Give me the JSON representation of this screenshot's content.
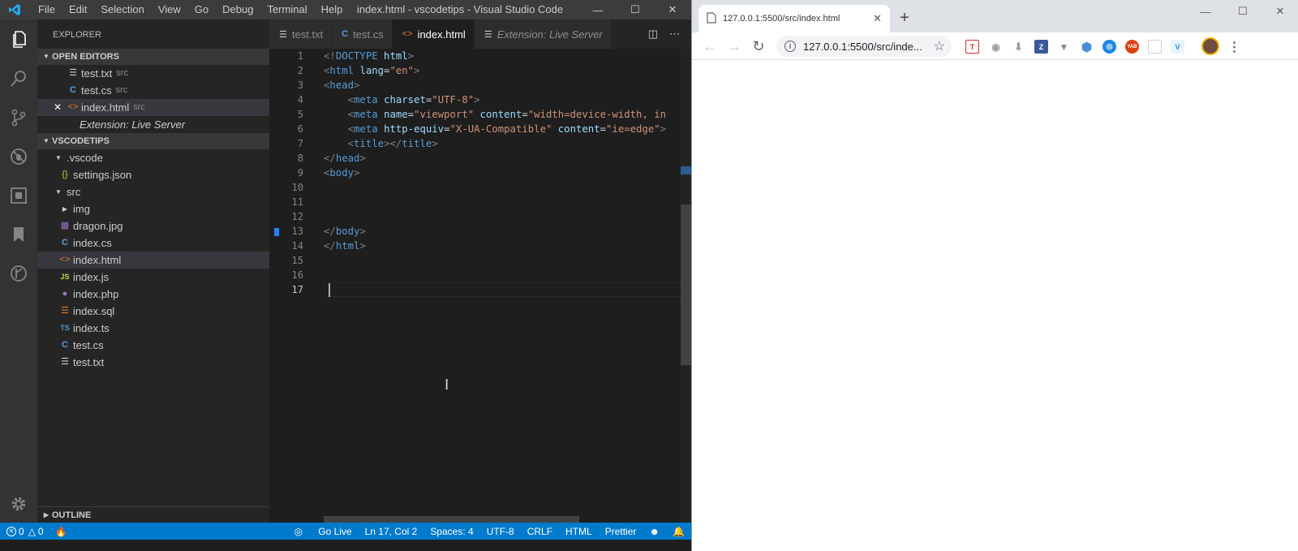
{
  "vscode": {
    "menu": [
      "File",
      "Edit",
      "Selection",
      "View",
      "Go",
      "Debug",
      "Terminal",
      "Help"
    ],
    "window_title": "index.html - vscodetips - Visual Studio Code",
    "sidebar_title": "EXPLORER",
    "open_editors_header": "OPEN EDITORS",
    "open_editors": [
      {
        "name": "test.txt",
        "folder": "src",
        "icon": "text-file-icon"
      },
      {
        "name": "test.cs",
        "folder": "src",
        "icon": "csharp-file-icon"
      },
      {
        "name": "index.html",
        "folder": "src",
        "icon": "html-file-icon"
      },
      {
        "name": "Extension: Live Server",
        "folder": "",
        "icon": "none"
      }
    ],
    "workspace_header": "VSCODETIPS",
    "tree": [
      {
        "name": ".vscode",
        "type": "folder-open"
      },
      {
        "name": "settings.json",
        "type": "json-file"
      },
      {
        "name": "src",
        "type": "folder-open"
      },
      {
        "name": "img",
        "type": "folder-closed"
      },
      {
        "name": "dragon.jpg",
        "type": "image-file"
      },
      {
        "name": "index.cs",
        "type": "csharp-file"
      },
      {
        "name": "index.html",
        "type": "html-file"
      },
      {
        "name": "index.js",
        "type": "js-file"
      },
      {
        "name": "index.php",
        "type": "php-file"
      },
      {
        "name": "index.sql",
        "type": "sql-file"
      },
      {
        "name": "index.ts",
        "type": "ts-file"
      },
      {
        "name": "test.cs",
        "type": "csharp-file"
      },
      {
        "name": "test.txt",
        "type": "text-file"
      }
    ],
    "outline_header": "OUTLINE",
    "tabs": [
      {
        "label": "test.txt",
        "icon": "text-file-icon"
      },
      {
        "label": "test.cs",
        "icon": "csharp-file-icon"
      },
      {
        "label": "index.html",
        "icon": "html-file-icon"
      },
      {
        "label": "Extension: Live Server",
        "icon": "extension-icon"
      }
    ],
    "line_numbers": [
      "1",
      "2",
      "3",
      "4",
      "5",
      "6",
      "7",
      "8",
      "9",
      "10",
      "11",
      "12",
      "13",
      "14",
      "15",
      "16",
      "17"
    ],
    "code_lines": [
      [
        [
          "p",
          "<!"
        ],
        [
          "t",
          "DOCTYPE"
        ],
        [
          "d",
          " "
        ],
        [
          "a",
          "html"
        ],
        [
          "p",
          ">"
        ]
      ],
      [
        [
          "p",
          "<"
        ],
        [
          "t",
          "html"
        ],
        [
          "d",
          " "
        ],
        [
          "a",
          "lang"
        ],
        [
          "d",
          "="
        ],
        [
          "s",
          "\"en\""
        ],
        [
          "p",
          ">"
        ]
      ],
      [
        [
          "p",
          "<"
        ],
        [
          "t",
          "head"
        ],
        [
          "p",
          ">"
        ]
      ],
      [
        [
          "d",
          "    "
        ],
        [
          "p",
          "<"
        ],
        [
          "t",
          "meta"
        ],
        [
          "d",
          " "
        ],
        [
          "a",
          "charset"
        ],
        [
          "d",
          "="
        ],
        [
          "s",
          "\"UTF-8\""
        ],
        [
          "p",
          ">"
        ]
      ],
      [
        [
          "d",
          "    "
        ],
        [
          "p",
          "<"
        ],
        [
          "t",
          "meta"
        ],
        [
          "d",
          " "
        ],
        [
          "a",
          "name"
        ],
        [
          "d",
          "="
        ],
        [
          "s",
          "\"viewport\""
        ],
        [
          "d",
          " "
        ],
        [
          "a",
          "content"
        ],
        [
          "d",
          "="
        ],
        [
          "s",
          "\"width=device-width, in"
        ]
      ],
      [
        [
          "d",
          "    "
        ],
        [
          "p",
          "<"
        ],
        [
          "t",
          "meta"
        ],
        [
          "d",
          " "
        ],
        [
          "a",
          "http-equiv"
        ],
        [
          "d",
          "="
        ],
        [
          "s",
          "\"X-UA-Compatible\""
        ],
        [
          "d",
          " "
        ],
        [
          "a",
          "content"
        ],
        [
          "d",
          "="
        ],
        [
          "s",
          "\"ie=edge\""
        ],
        [
          "p",
          ">"
        ]
      ],
      [
        [
          "d",
          "    "
        ],
        [
          "p",
          "<"
        ],
        [
          "t",
          "title"
        ],
        [
          "p",
          "></"
        ],
        [
          "t",
          "title"
        ],
        [
          "p",
          ">"
        ]
      ],
      [
        [
          "p",
          "</"
        ],
        [
          "t",
          "head"
        ],
        [
          "p",
          ">"
        ]
      ],
      [
        [
          "p",
          "<"
        ],
        [
          "t",
          "body"
        ],
        [
          "p",
          ">"
        ]
      ],
      [],
      [],
      [],
      [
        [
          "p",
          "</"
        ],
        [
          "t",
          "body"
        ],
        [
          "p",
          ">"
        ]
      ],
      [
        [
          "p",
          "</"
        ],
        [
          "t",
          "html"
        ],
        [
          "p",
          ">"
        ]
      ],
      [],
      [],
      []
    ],
    "status": {
      "errors": "0",
      "warnings": "0",
      "go_live": "Go Live",
      "position": "Ln 17, Col 2",
      "spaces": "Spaces: 4",
      "encoding": "UTF-8",
      "eol": "CRLF",
      "language": "HTML",
      "formatter": "Prettier"
    },
    "colors": {
      "status_bar": "#007acc",
      "activity_bar": "#333333",
      "sidebar": "#252526",
      "editor": "#1e1e1e"
    }
  },
  "browser": {
    "tab_title": "127.0.0.1:5500/src/index.html",
    "address": "127.0.0.1:5500/src/inde...",
    "extensions": [
      "T",
      "camera",
      "download",
      "Z",
      "V",
      "shield",
      "circle",
      "YAB",
      "blank",
      "V2",
      "avatar"
    ]
  }
}
